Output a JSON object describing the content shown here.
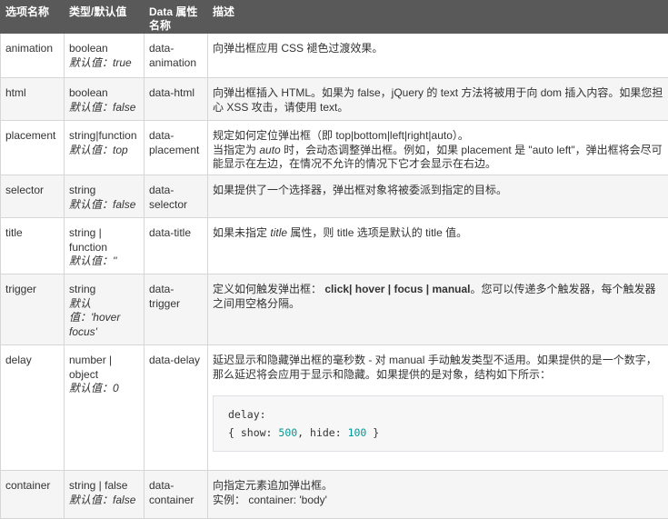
{
  "headers": [
    "选项名称",
    "类型/默认值",
    "Data 属性名称",
    "描述"
  ],
  "default_label": "默认值：",
  "rows": {
    "animation": {
      "name": "animation",
      "type": "boolean",
      "default": "true",
      "data_attr": "data-animation",
      "desc": "向弹出框应用 CSS 褪色过渡效果。"
    },
    "html": {
      "name": "html",
      "type": "boolean",
      "default": "false",
      "data_attr": "data-html",
      "desc": "向弹出框插入 HTML。如果为 false，jQuery 的 text 方法将被用于向 dom 插入内容。如果您担心 XSS 攻击，请使用 text。"
    },
    "placement": {
      "name": "placement",
      "type": "string|function",
      "default": "top",
      "data_attr": "data-placement",
      "desc_line1": "规定如何定位弹出框（即 top|bottom|left|right|auto）。",
      "desc_line2_pre": "当指定为",
      "desc_line2_ital": "auto",
      "desc_line2_post": "时，会动态调整弹出框。例如，如果 placement 是 \"auto left\"，弹出框将会尽可能显示在左边，在情况不允许的情况下它才会显示在右边。"
    },
    "selector": {
      "name": "selector",
      "type": "string",
      "default": "false",
      "data_attr": "data-selector",
      "desc": "如果提供了一个选择器，弹出框对象将被委派到指定的目标。"
    },
    "title": {
      "name": "title",
      "type": "string | function",
      "default": "''",
      "data_attr": "data-title",
      "desc_pre": "如果未指定",
      "desc_ital": "title",
      "desc_post": "属性，则 title 选项是默认的 title 值。"
    },
    "trigger": {
      "name": "trigger",
      "type": "string",
      "default": "'hover focus'",
      "data_attr": "data-trigger",
      "desc_pre": "定义如何触发弹出框：",
      "desc_bold": "click| hover | focus | manual",
      "desc_post": "。您可以传递多个触发器，每个触发器之间用空格分隔。"
    },
    "delay": {
      "name": "delay",
      "type": "number | object",
      "default": "0",
      "data_attr": "data-delay",
      "desc": "延迟显示和隐藏弹出框的毫秒数 - 对 manual 手动触发类型不适用。如果提供的是一个数字，那么延迟将会应用于显示和隐藏。如果提供的是对象，结构如下所示：",
      "code_line1": "delay:",
      "code_pre": "{ show: ",
      "code_show": "500",
      "code_mid": ", hide: ",
      "code_hide": "100",
      "code_post": " }"
    },
    "container": {
      "name": "container",
      "type": "string | false",
      "default": "false",
      "data_attr": "data-container",
      "desc_line1": "向指定元素追加弹出框。",
      "desc_line2": "实例： container: 'body'"
    }
  }
}
